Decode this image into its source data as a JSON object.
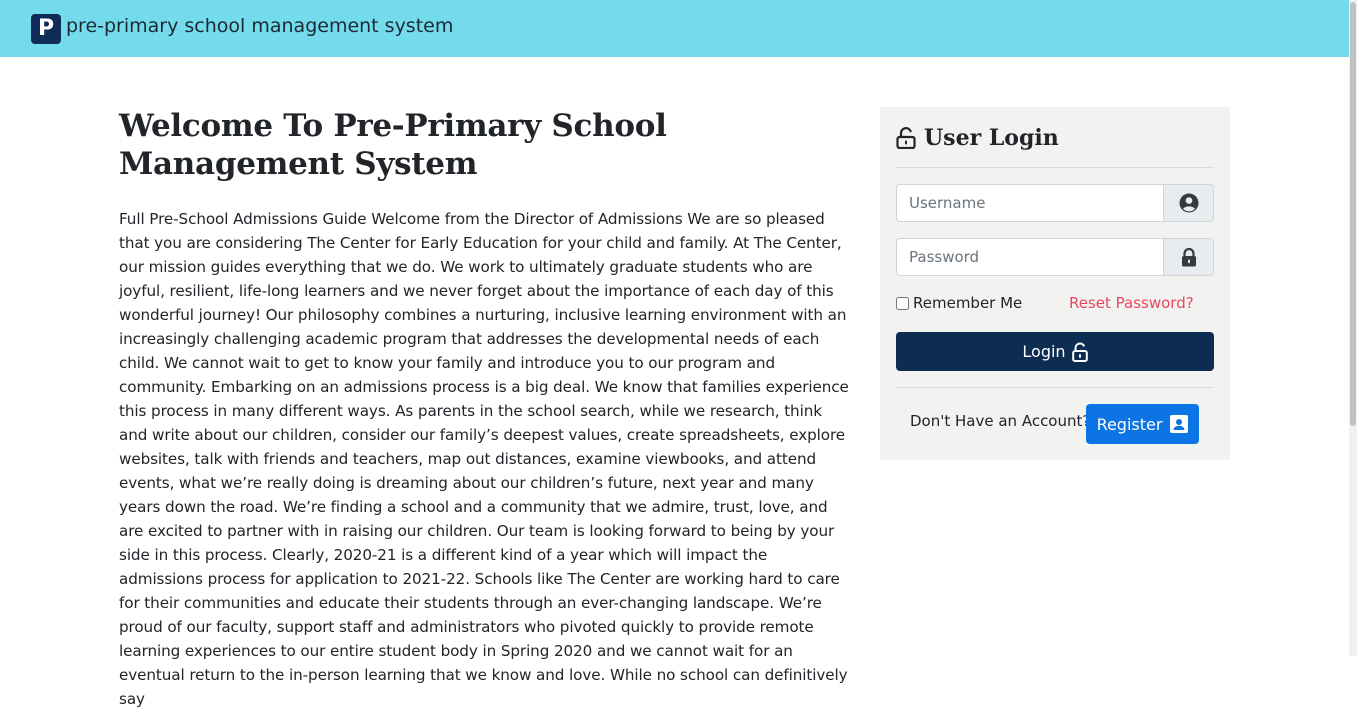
{
  "header": {
    "logo_letter": "P",
    "brand_name": "pre-primary school management system"
  },
  "main": {
    "title": "Welcome To Pre-Primary School Management System",
    "intro": "Full Pre-School Admissions Guide Welcome from the Director of Admissions We are so pleased that you are considering The Center for Early Education for your child and family. At The Center, our mission guides everything that we do. We work to ultimately graduate students who are joyful, resilient, life-long learners and we never forget about the importance of each day of this wonderful journey! Our philosophy combines a nurturing, inclusive learning environment with an increasingly challenging academic program that addresses the developmental needs of each child. We cannot wait to get to know your family and introduce you to our program and community. Embarking on an admissions process is a big deal. We know that families experience this process in many different ways. As parents in the school search, while we research, think and write about our children, consider our family’s deepest values, create spreadsheets, explore websites, talk with friends and teachers, map out distances, examine viewbooks, and attend events, what we’re really doing is dreaming about our children’s future, next year and many years down the road. We’re finding a school and a community that we admire, trust, love, and are excited to partner with in raising our children. Our team is looking forward to being by your side in this process. Clearly, 2020-21 is a different kind of a year which will impact the admissions process for application to 2021-22. Schools like The Center are working hard to care for their communities and educate their students through an ever-changing landscape. We’re proud of our faculty, support staff and administrators who pivoted quickly to provide remote learning experiences to our entire student body in Spring 2020 and we cannot wait for an eventual return to the in-person learning that we know and love. While no school can definitively say"
  },
  "login": {
    "title": "User Login",
    "username_placeholder": "Username",
    "password_placeholder": "Password",
    "remember_label": "Remember Me",
    "remember_checked": false,
    "reset_label": "Reset Password?",
    "login_label": "Login",
    "no_account_text": "Don't Have an Account?",
    "register_label": "Register"
  },
  "colors": {
    "header_bg": "#74dbed",
    "logo_bg": "#0f2b57",
    "card_bg": "#f2f2f0",
    "login_button": "#0c2c52",
    "register_button": "#0d74e5",
    "reset_link": "#e8475f"
  },
  "icons": {
    "title_icon": "unlock-icon",
    "username_icon": "user-circle-icon",
    "password_icon": "lock-icon",
    "login_icon": "unlock-icon",
    "register_icon": "id-card-icon"
  }
}
